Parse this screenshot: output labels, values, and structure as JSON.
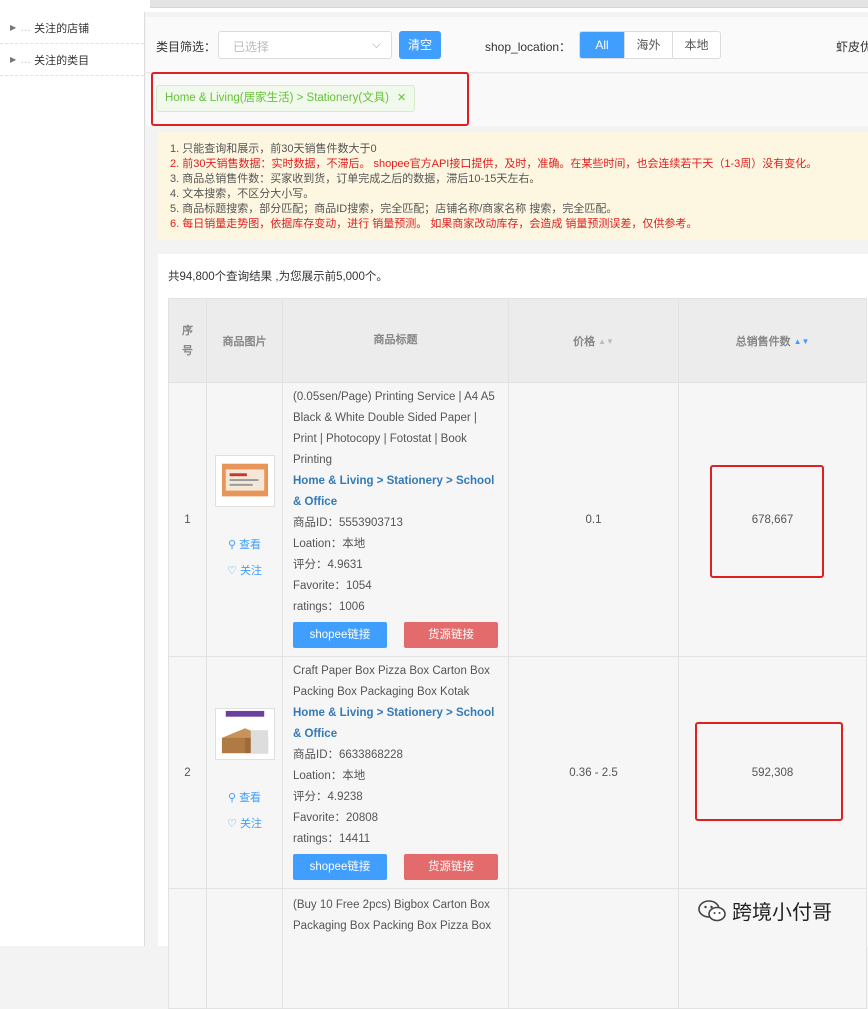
{
  "sidebar": {
    "items": [
      {
        "label": "关注的店铺"
      },
      {
        "label": "关注的类目"
      }
    ]
  },
  "filters": {
    "category_label": "类目筛选：",
    "category_placeholder": "已选择",
    "clear_button": "清空",
    "location_label": "shop_location：",
    "location_options": [
      "All",
      "海外",
      "本地"
    ],
    "location_selected": "All",
    "cutoff_label": "虾皮优"
  },
  "selected_tag": "Home & Living(居家生活) > Stationery(文具)",
  "notice": [
    {
      "text": "1. 只能查询和展示，前30天销售件数大于0",
      "color": "normal"
    },
    {
      "text": "2. 前30天销售数据：实时数据，不滞后。 shopee官方API接口提供，及时，准确。在某些时间，也会连续若干天（1-3周）没有变化。",
      "color": "red"
    },
    {
      "text": "3. 商品总销售件数：买家收到货，订单完成之后的数据，滞后10-15天左右。",
      "color": "normal"
    },
    {
      "text": "4. 文本搜索，不区分大小写。",
      "color": "normal"
    },
    {
      "text": "5. 商品标题搜索，部分匹配；商品ID搜索，完全匹配；店铺名称/商家名称 搜索，完全匹配。",
      "color": "normal"
    },
    {
      "text": "6. 每日销量走势图，依据库存变动，进行 销量预测。 如果商家改动库存，会造成 销量预测误差，仅供参考。",
      "color": "red"
    }
  ],
  "result_count": "共94,800个查询结果 ,为您展示前5,000个。",
  "table": {
    "headers": {
      "index": "序号",
      "image": "商品图片",
      "title": "商品标题",
      "price": "价格",
      "sales": "总销售件数"
    },
    "view_label": "查看",
    "follow_label": "关注",
    "shopee_button": "shopee链接",
    "source_button": "货源链接",
    "rows": [
      {
        "index": "1",
        "title": "(0.05sen/Page) Printing Service | A4 A5 Black & White Double Sided Paper | Print | Photocopy | Fotostat | Book Printing",
        "category": "Home & Living > Stationery > School & Office",
        "product_id": "商品ID：5553903713",
        "location": "Loation：本地",
        "rating": "评分：4.9631",
        "favorite": "Favorite：1054",
        "ratings": "ratings：1006",
        "price": "0.1",
        "sales": "678,667"
      },
      {
        "index": "2",
        "title": "Craft Paper Box Pizza Box Carton Box Packing Box Packaging Box Kotak",
        "category": "Home & Living > Stationery > School & Office",
        "product_id": "商品ID：6633868228",
        "location": "Loation：本地",
        "rating": "评分：4.9238",
        "favorite": "Favorite：20808",
        "ratings": "ratings：14411",
        "price": "0.36 - 2.5",
        "sales": "592,308"
      },
      {
        "index": "",
        "title": "(Buy 10 Free 2pcs) Bigbox Carton Box Packaging Box Packing Box Pizza Box"
      }
    ]
  },
  "watermark": "跨境小付哥",
  "colors": {
    "primary": "#409eff",
    "danger": "#e02020",
    "tag_green": "#67c23a",
    "link_blue": "#337ab7"
  }
}
